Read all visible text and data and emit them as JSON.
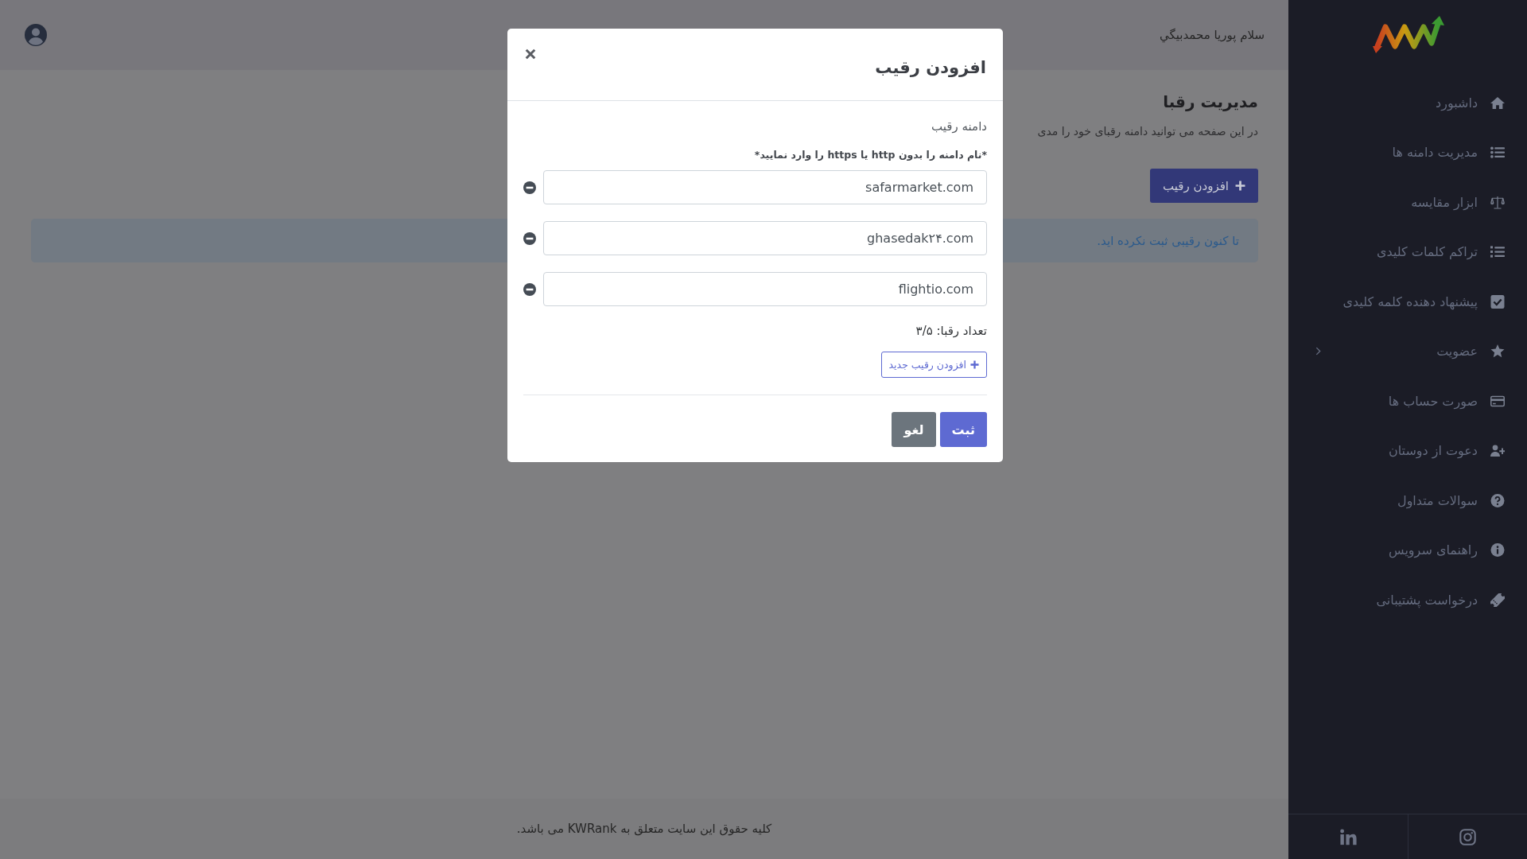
{
  "sidebar": {
    "items": [
      {
        "label": "داشبورد",
        "selected": false,
        "has_submenu": false
      },
      {
        "label": "مدیریت دامنه ها",
        "selected": false,
        "has_submenu": false
      },
      {
        "label": "ابزار مقایسه",
        "selected": false,
        "has_submenu": false
      },
      {
        "label": "تراکم کلمات کلیدی",
        "selected": false,
        "has_submenu": false
      },
      {
        "label": "پیشنهاد دهنده کلمه کلیدی",
        "selected": false,
        "has_submenu": false
      },
      {
        "label": "عضویت",
        "selected": false,
        "has_submenu": true
      },
      {
        "label": "صورت حساب ها",
        "selected": false,
        "has_submenu": false
      },
      {
        "label": "دعوت از دوستان",
        "selected": false,
        "has_submenu": false
      },
      {
        "label": "سوالات متداول",
        "selected": false,
        "has_submenu": false
      },
      {
        "label": "راهنمای سرویس",
        "selected": false,
        "has_submenu": false
      },
      {
        "label": "درخواست پشتیبانی",
        "selected": false,
        "has_submenu": false
      }
    ]
  },
  "header": {
    "greeting": "سلام پوریا محمدبیگي"
  },
  "page": {
    "title": "مدیریت رقبا",
    "description": "در این صفحه می توانید دامنه رقبای خود را مدی",
    "add_button": "افزودن رقیب",
    "alert": "تا کنون رقیبی ثبت نکرده اید."
  },
  "footer": {
    "text": "کلیه حقوق این سایت متعلق به KWRank می باشد."
  },
  "modal": {
    "title": "افزودن رقیب",
    "field_label": "دامنه رقیب",
    "hint": "*نام دامنه را بدون http یا https را وارد نمایید*",
    "domains": [
      {
        "value": "safarmarket.com"
      },
      {
        "value": "ghasedak۲۴.com"
      },
      {
        "value": "flightio.com"
      }
    ],
    "count": "تعداد رقبا: ۳/۵",
    "add_new_button": "افزودن رقیب جدید",
    "buttons": [
      {
        "label": "ثبت",
        "kind": "primary"
      },
      {
        "label": "لغو",
        "kind": "secondary"
      }
    ]
  }
}
